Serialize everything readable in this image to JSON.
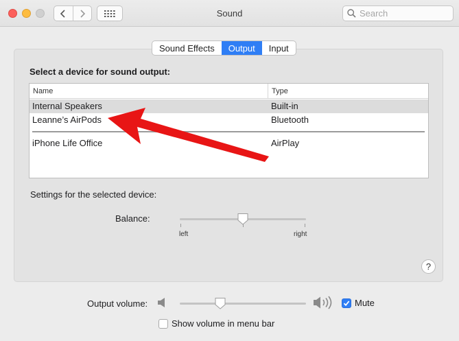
{
  "window": {
    "title": "Sound"
  },
  "search": {
    "placeholder": "Search"
  },
  "tabs": [
    {
      "label": "Sound Effects",
      "active": false
    },
    {
      "label": "Output",
      "active": true
    },
    {
      "label": "Input",
      "active": false
    }
  ],
  "output": {
    "section_title": "Select a device for sound output:",
    "columns": {
      "name": "Name",
      "type": "Type"
    },
    "devices": [
      {
        "name": "Internal Speakers",
        "type": "Built-in",
        "selected": true
      },
      {
        "name": "Leanne’s AirPods",
        "type": "Bluetooth",
        "selected": false
      },
      {
        "name": "iPhone Life Office",
        "type": "AirPlay",
        "selected": false
      }
    ],
    "settings_label": "Settings for the selected device:",
    "balance": {
      "label": "Balance:",
      "left_label": "left",
      "right_label": "right",
      "value": 0.5
    }
  },
  "help": {
    "label": "?"
  },
  "volume": {
    "label": "Output volume:",
    "value": 0.32,
    "mute_label": "Mute",
    "muted": true
  },
  "menubar": {
    "label": "Show volume in menu bar",
    "checked": false
  },
  "annotation": {
    "arrow_color": "#e81515"
  },
  "colors": {
    "accent": "#2f7ef5"
  },
  "icons": [
    "back-chevron-icon",
    "forward-chevron-icon",
    "grid-icon",
    "search-icon",
    "speaker-low-icon",
    "speaker-high-icon",
    "checkmark-icon",
    "help-icon",
    "red-arrow-annotation"
  ]
}
